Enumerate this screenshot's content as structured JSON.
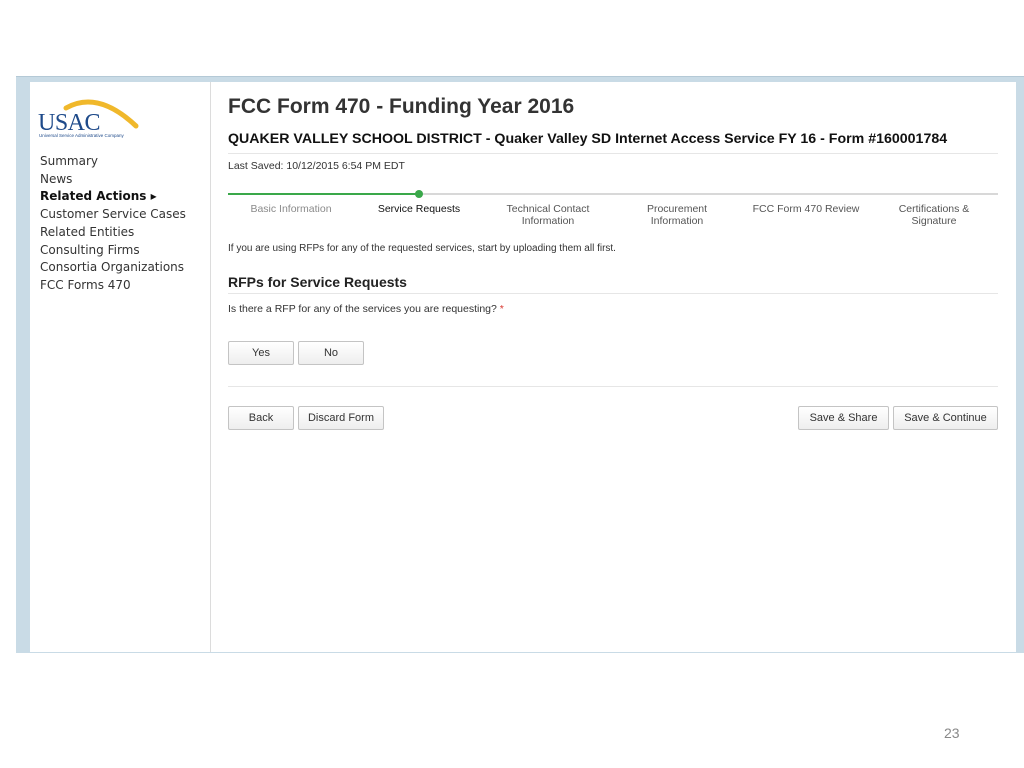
{
  "logo": {
    "text": "USAC",
    "subtitle": "Universal Service Administrative Company"
  },
  "sidebar": {
    "items": [
      {
        "label": "Summary"
      },
      {
        "label": "News"
      },
      {
        "label": "Related Actions ▸"
      },
      {
        "label": "Customer Service Cases"
      },
      {
        "label": "Related Entities"
      },
      {
        "label": "Consulting Firms"
      },
      {
        "label": "Consortia Organizations"
      },
      {
        "label": "FCC Forms 470"
      }
    ]
  },
  "header": {
    "title": "FCC Form 470 - Funding Year 2016",
    "subtitle": "QUAKER VALLEY SCHOOL DISTRICT - Quaker Valley SD Internet Access Service FY 16 - Form #160001784",
    "last_saved": "Last Saved: 10/12/2015 6:54 PM EDT"
  },
  "progress": {
    "steps": [
      {
        "line1": "Basic Information",
        "line2": "",
        "state": "done"
      },
      {
        "line1": "Service Requests",
        "line2": "",
        "state": "current"
      },
      {
        "line1": "Technical Contact",
        "line2": "Information",
        "state": "upcoming"
      },
      {
        "line1": "Procurement",
        "line2": "Information",
        "state": "upcoming"
      },
      {
        "line1": "FCC Form 470 Review",
        "line2": "",
        "state": "upcoming"
      },
      {
        "line1": "Certifications &",
        "line2": "Signature",
        "state": "upcoming"
      }
    ]
  },
  "main": {
    "info": "If you are using RFPs for any of the requested services, start by uploading them all first.",
    "section_title": "RFPs for Service Requests",
    "question": "Is there a RFP for any of the services you are requesting?",
    "required_mark": "*",
    "yes_label": "Yes",
    "no_label": "No"
  },
  "footer": {
    "back_label": "Back",
    "discard_label": "Discard Form",
    "save_share_label": "Save & Share",
    "save_continue_label": "Save & Continue"
  },
  "slide": {
    "page_number": "23"
  },
  "colors": {
    "accent_green": "#3aa84a",
    "brand_blue": "#1e4a8a",
    "logo_gold": "#f0b82b",
    "required_red": "#d9362f"
  }
}
